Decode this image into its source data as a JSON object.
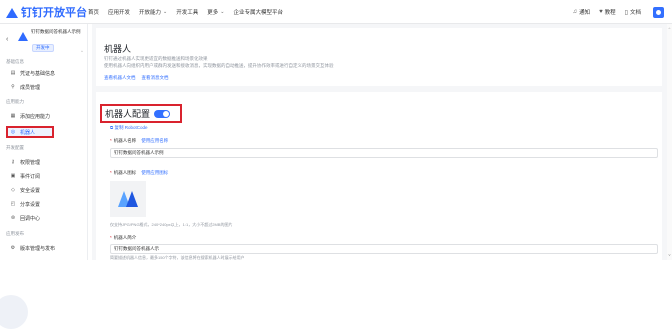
{
  "topbar": {
    "logo_text": "钉钉开放平台",
    "nav": [
      {
        "label": "首页",
        "caret": false
      },
      {
        "label": "应用开发",
        "caret": false
      },
      {
        "label": "开放能力",
        "caret": true
      },
      {
        "label": "开发工具",
        "caret": false
      },
      {
        "label": "更多",
        "caret": true
      },
      {
        "label": "企业专属大模型平台",
        "caret": false
      }
    ],
    "right": {
      "notify": "通知",
      "course": "教程",
      "docs": "文档"
    }
  },
  "sidebar": {
    "app_name": "钉钉数据问答机器人示例",
    "app_tag": "开发中",
    "sections": [
      {
        "label": "基础信息",
        "items": [
          {
            "label": "凭证与基础信息",
            "icon": "doc-icon"
          },
          {
            "label": "成员管理",
            "icon": "user-icon"
          }
        ]
      },
      {
        "label": "应用能力",
        "items": [
          {
            "label": "添加应用能力",
            "icon": "grid-icon"
          },
          {
            "label": "机器人",
            "icon": "robot-icon",
            "active": true
          }
        ]
      },
      {
        "label": "开发配置",
        "items": [
          {
            "label": "权限管理",
            "icon": "key-icon"
          },
          {
            "label": "事件订阅",
            "icon": "list-icon"
          },
          {
            "label": "安全设置",
            "icon": "shield-icon"
          },
          {
            "label": "分享设置",
            "icon": "share-icon"
          },
          {
            "label": "回调中心",
            "icon": "callback-icon"
          }
        ]
      },
      {
        "label": "应用发布",
        "items": [
          {
            "label": "版本管理与发布",
            "icon": "gear-icon"
          }
        ]
      }
    ]
  },
  "main": {
    "intro": {
      "title": "机器人",
      "desc1": "钉钉通过机器人实现更适宜的数据推送和场景化效果",
      "desc2": "使用机器人向组织内用户或群内发送和接收消息，实现数据的自动推送，提升协作效率或进行自定义的场景交互体验",
      "link1": "查看机器人文档",
      "link2": "查看消息文档"
    },
    "config": {
      "title": "机器人配置",
      "enabled": true,
      "copy_link": "复制 RobotCode",
      "name_label": "机器人名称",
      "name_link": "使用应用名称",
      "name_value": "钉钉数据问答机器人示例",
      "icon_label": "机器人图标",
      "icon_link": "使用应用图标",
      "icon_hint": "仅支持JPG/PNG格式，240*240px以上，1:1，大小不超过2MB的图片",
      "intro_label": "机器人简介",
      "intro_value": "钉钉数据问答机器人示",
      "intro_hint": "简要描述机器人信息，最多150个字符，该信息将在搜索机器人时展示给用户"
    }
  }
}
